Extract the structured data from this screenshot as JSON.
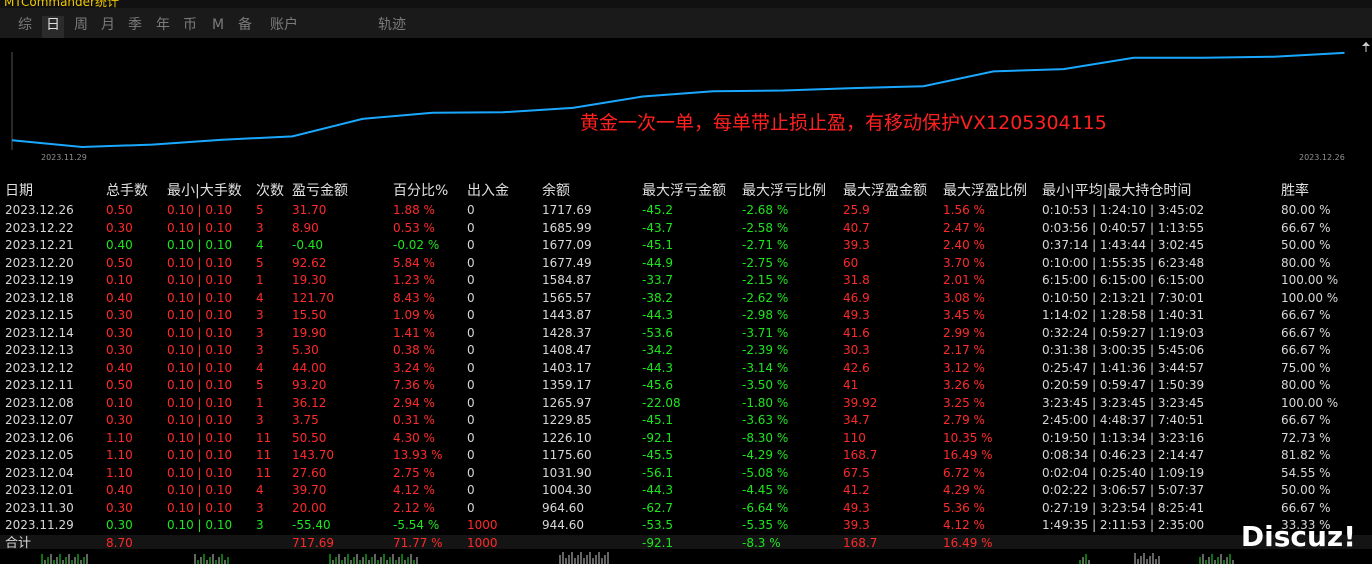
{
  "window": {
    "title": "MTCommander统计"
  },
  "tabs": [
    {
      "label": "综",
      "active": false
    },
    {
      "label": "日",
      "active": true
    },
    {
      "label": "周",
      "active": false
    },
    {
      "label": "月",
      "active": false
    },
    {
      "label": "季",
      "active": false
    },
    {
      "label": "年",
      "active": false
    },
    {
      "label": "币",
      "active": false
    },
    {
      "label": "M",
      "active": false
    },
    {
      "label": "备",
      "active": false
    },
    {
      "label": "账户",
      "active": false
    },
    {
      "label": "轨迹",
      "active": false
    }
  ],
  "chart_data": {
    "type": "line",
    "x_start_label": "2023.11.29",
    "x_end_label": "2023.12.26",
    "x": [
      "2023.11.29",
      "2023.11.30",
      "2023.12.01",
      "2023.12.04",
      "2023.12.05",
      "2023.12.06",
      "2023.12.07",
      "2023.12.08",
      "2023.12.11",
      "2023.12.12",
      "2023.12.13",
      "2023.12.14",
      "2023.12.15",
      "2023.12.18",
      "2023.12.19",
      "2023.12.20",
      "2023.12.21",
      "2023.12.22",
      "2023.12.26"
    ],
    "values": [
      944.6,
      964.6,
      1004.3,
      1031.9,
      1175.6,
      1226.1,
      1229.85,
      1265.97,
      1359.17,
      1403.17,
      1408.47,
      1428.37,
      1443.87,
      1565.57,
      1584.87,
      1677.49,
      1677.09,
      1685.99,
      1717.69
    ],
    "series_color": "#1aa8ff",
    "annotation": "黄金一次一单，每单带止损止盈，有移动保护VX1205304115"
  },
  "table": {
    "headers": [
      "日期",
      "总手数",
      "最小|大手数",
      "次数",
      "盈亏金额",
      "百分比%",
      "出入金",
      "余额",
      "最大浮亏金额",
      "最大浮亏比例",
      "最大浮盈金额",
      "最大浮盈比例",
      "最小|平均|最大持仓时间",
      "胜率"
    ],
    "rows": [
      {
        "date": "2023.12.26",
        "lots": "0.50",
        "minmax": "0.10 | 0.10",
        "count": "5",
        "pl": "31.70",
        "pct": "1.88 %",
        "fund": "0",
        "bal": "1717.69",
        "mfl": "-45.2",
        "mflp": "-2.68 %",
        "mfp": "25.9",
        "mfpp": "1.56 %",
        "dur": "0:10:53 | 1:24:10 | 3:45:02",
        "win": "80.00 %",
        "color": "red"
      },
      {
        "date": "2023.12.22",
        "lots": "0.30",
        "minmax": "0.10 | 0.10",
        "count": "3",
        "pl": "8.90",
        "pct": "0.53 %",
        "fund": "0",
        "bal": "1685.99",
        "mfl": "-43.7",
        "mflp": "-2.58 %",
        "mfp": "40.7",
        "mfpp": "2.47 %",
        "dur": "0:03:56 | 0:40:57 | 1:13:55",
        "win": "66.67 %",
        "color": "red"
      },
      {
        "date": "2023.12.21",
        "lots": "0.40",
        "minmax": "0.10 | 0.10",
        "count": "4",
        "pl": "-0.40",
        "pct": "-0.02 %",
        "fund": "0",
        "bal": "1677.09",
        "mfl": "-45.1",
        "mflp": "-2.71 %",
        "mfp": "39.3",
        "mfpp": "2.40 %",
        "dur": "0:37:14 | 1:43:44 | 3:02:45",
        "win": "50.00 %",
        "color": "green"
      },
      {
        "date": "2023.12.20",
        "lots": "0.50",
        "minmax": "0.10 | 0.10",
        "count": "5",
        "pl": "92.62",
        "pct": "5.84 %",
        "fund": "0",
        "bal": "1677.49",
        "mfl": "-44.9",
        "mflp": "-2.75 %",
        "mfp": "60",
        "mfpp": "3.70 %",
        "dur": "0:10:00 | 1:55:35 | 6:23:48",
        "win": "80.00 %",
        "color": "red"
      },
      {
        "date": "2023.12.19",
        "lots": "0.10",
        "minmax": "0.10 | 0.10",
        "count": "1",
        "pl": "19.30",
        "pct": "1.23 %",
        "fund": "0",
        "bal": "1584.87",
        "mfl": "-33.7",
        "mflp": "-2.15 %",
        "mfp": "31.8",
        "mfpp": "2.01 %",
        "dur": "6:15:00 | 6:15:00 | 6:15:00",
        "win": "100.00 %",
        "color": "red"
      },
      {
        "date": "2023.12.18",
        "lots": "0.40",
        "minmax": "0.10 | 0.10",
        "count": "4",
        "pl": "121.70",
        "pct": "8.43 %",
        "fund": "0",
        "bal": "1565.57",
        "mfl": "-38.2",
        "mflp": "-2.62 %",
        "mfp": "46.9",
        "mfpp": "3.08 %",
        "dur": "0:10:50 | 2:13:21 | 7:30:01",
        "win": "100.00 %",
        "color": "red"
      },
      {
        "date": "2023.12.15",
        "lots": "0.30",
        "minmax": "0.10 | 0.10",
        "count": "3",
        "pl": "15.50",
        "pct": "1.09 %",
        "fund": "0",
        "bal": "1443.87",
        "mfl": "-44.3",
        "mflp": "-2.98 %",
        "mfp": "49.3",
        "mfpp": "3.45 %",
        "dur": "1:14:02 | 1:28:58 | 1:40:31",
        "win": "66.67 %",
        "color": "red"
      },
      {
        "date": "2023.12.14",
        "lots": "0.30",
        "minmax": "0.10 | 0.10",
        "count": "3",
        "pl": "19.90",
        "pct": "1.41 %",
        "fund": "0",
        "bal": "1428.37",
        "mfl": "-53.6",
        "mflp": "-3.71 %",
        "mfp": "41.6",
        "mfpp": "2.99 %",
        "dur": "0:32:24 | 0:59:27 | 1:19:03",
        "win": "66.67 %",
        "color": "red"
      },
      {
        "date": "2023.12.13",
        "lots": "0.30",
        "minmax": "0.10 | 0.10",
        "count": "3",
        "pl": "5.30",
        "pct": "0.38 %",
        "fund": "0",
        "bal": "1408.47",
        "mfl": "-34.2",
        "mflp": "-2.39 %",
        "mfp": "30.3",
        "mfpp": "2.17 %",
        "dur": "0:31:38 | 3:00:35 | 5:45:06",
        "win": "66.67 %",
        "color": "red"
      },
      {
        "date": "2023.12.12",
        "lots": "0.40",
        "minmax": "0.10 | 0.10",
        "count": "4",
        "pl": "44.00",
        "pct": "3.24 %",
        "fund": "0",
        "bal": "1403.17",
        "mfl": "-44.3",
        "mflp": "-3.14 %",
        "mfp": "42.6",
        "mfpp": "3.12 %",
        "dur": "0:25:47 | 1:41:36 | 3:44:57",
        "win": "75.00 %",
        "color": "red"
      },
      {
        "date": "2023.12.11",
        "lots": "0.50",
        "minmax": "0.10 | 0.10",
        "count": "5",
        "pl": "93.20",
        "pct": "7.36 %",
        "fund": "0",
        "bal": "1359.17",
        "mfl": "-45.6",
        "mflp": "-3.50 %",
        "mfp": "41",
        "mfpp": "3.26 %",
        "dur": "0:20:59 | 0:59:47 | 1:50:39",
        "win": "80.00 %",
        "color": "red"
      },
      {
        "date": "2023.12.08",
        "lots": "0.10",
        "minmax": "0.10 | 0.10",
        "count": "1",
        "pl": "36.12",
        "pct": "2.94 %",
        "fund": "0",
        "bal": "1265.97",
        "mfl": "-22.08",
        "mflp": "-1.80 %",
        "mfp": "39.92",
        "mfpp": "3.25 %",
        "dur": "3:23:45 | 3:23:45 | 3:23:45",
        "win": "100.00 %",
        "color": "red"
      },
      {
        "date": "2023.12.07",
        "lots": "0.30",
        "minmax": "0.10 | 0.10",
        "count": "3",
        "pl": "3.75",
        "pct": "0.31 %",
        "fund": "0",
        "bal": "1229.85",
        "mfl": "-45.1",
        "mflp": "-3.63 %",
        "mfp": "34.7",
        "mfpp": "2.79 %",
        "dur": "2:45:00 | 4:48:37 | 7:40:51",
        "win": "66.67 %",
        "color": "red"
      },
      {
        "date": "2023.12.06",
        "lots": "1.10",
        "minmax": "0.10 | 0.10",
        "count": "11",
        "pl": "50.50",
        "pct": "4.30 %",
        "fund": "0",
        "bal": "1226.10",
        "mfl": "-92.1",
        "mflp": "-8.30 %",
        "mfp": "110",
        "mfpp": "10.35 %",
        "dur": "0:19:50 | 1:13:34 | 3:23:16",
        "win": "72.73 %",
        "color": "red"
      },
      {
        "date": "2023.12.05",
        "lots": "1.10",
        "minmax": "0.10 | 0.10",
        "count": "11",
        "pl": "143.70",
        "pct": "13.93 %",
        "fund": "0",
        "bal": "1175.60",
        "mfl": "-45.5",
        "mflp": "-4.29 %",
        "mfp": "168.7",
        "mfpp": "16.49 %",
        "dur": "0:08:34 | 0:46:23 | 2:14:47",
        "win": "81.82 %",
        "color": "red"
      },
      {
        "date": "2023.12.04",
        "lots": "1.10",
        "minmax": "0.10 | 0.10",
        "count": "11",
        "pl": "27.60",
        "pct": "2.75 %",
        "fund": "0",
        "bal": "1031.90",
        "mfl": "-56.1",
        "mflp": "-5.08 %",
        "mfp": "67.5",
        "mfpp": "6.72 %",
        "dur": "0:02:04 | 0:25:40 | 1:09:19",
        "win": "54.55 %",
        "color": "red"
      },
      {
        "date": "2023.12.01",
        "lots": "0.40",
        "minmax": "0.10 | 0.10",
        "count": "4",
        "pl": "39.70",
        "pct": "4.12 %",
        "fund": "0",
        "bal": "1004.30",
        "mfl": "-44.3",
        "mflp": "-4.45 %",
        "mfp": "41.2",
        "mfpp": "4.29 %",
        "dur": "0:02:22 | 3:06:57 | 5:07:37",
        "win": "50.00 %",
        "color": "red"
      },
      {
        "date": "2023.11.30",
        "lots": "0.30",
        "minmax": "0.10 | 0.10",
        "count": "3",
        "pl": "20.00",
        "pct": "2.12 %",
        "fund": "0",
        "bal": "964.60",
        "mfl": "-62.7",
        "mflp": "-6.64 %",
        "mfp": "49.3",
        "mfpp": "5.36 %",
        "dur": "0:27:19 | 3:23:54 | 8:25:41",
        "win": "66.67 %",
        "color": "red"
      },
      {
        "date": "2023.11.29",
        "lots": "0.30",
        "minmax": "0.10 | 0.10",
        "count": "3",
        "pl": "-55.40",
        "pct": "-5.54 %",
        "fund": "1000",
        "bal": "944.60",
        "mfl": "-53.5",
        "mflp": "-5.35 %",
        "mfp": "39.3",
        "mfpp": "4.12 %",
        "dur": "1:49:35 | 2:11:53 | 2:35:00",
        "win": "33.33 %",
        "color": "green"
      }
    ],
    "total": {
      "label": "合计",
      "lots": "8.70",
      "pl": "717.69",
      "pct": "71.77 %",
      "fund": "1000",
      "mfl": "-92.1",
      "mflp": "-8.3 %",
      "mfp": "168.7",
      "mfpp": "16.49 %"
    }
  },
  "watermark": "Discuz!",
  "colors": {
    "profit": "#ff2a2a",
    "loss": "#1ee61e",
    "line": "#1aa8ff",
    "background": "#000000"
  }
}
